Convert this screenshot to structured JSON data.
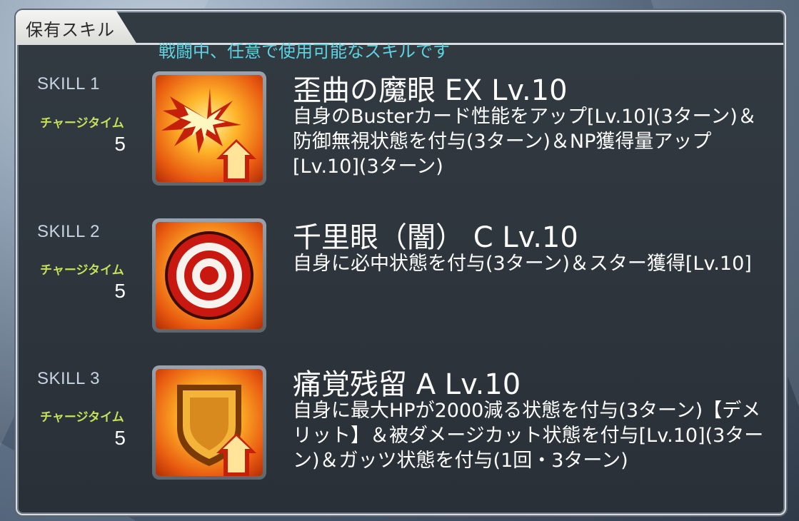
{
  "header": {
    "title": "保有スキル",
    "subtitle": "戦闘中、任意で使用可能なスキルです"
  },
  "charge_label": "チャージタイム",
  "skills": [
    {
      "slot": "SKILL 1",
      "charge": "5",
      "name": "歪曲の魔眼 EX Lv.10",
      "desc": "自身のBusterカード性能をアップ[Lv.10](3ターン)＆防御無視状態を付与(3ターン)＆NP獲得量アップ[Lv.10](3ターン)",
      "icon": "buster-up-icon"
    },
    {
      "slot": "SKILL 2",
      "charge": "5",
      "name": "千里眼（闇） C Lv.10",
      "desc": "自身に必中状態を付与(3ターン)＆スター獲得[Lv.10]",
      "icon": "target-icon"
    },
    {
      "slot": "SKILL 3",
      "charge": "5",
      "name": "痛覚残留 A Lv.10",
      "desc": "自身に最大HPが2000減る状態を付与(3ターン)【デメリット】＆被ダメージカット状態を付与[Lv.10](3ターン)＆ガッツ状態を付与(1回・3ターン)",
      "icon": "defense-up-icon"
    }
  ],
  "colors": {
    "subtitle": "#5cd4e0",
    "charge": "#c6e05a",
    "panel": "#2e353d"
  }
}
